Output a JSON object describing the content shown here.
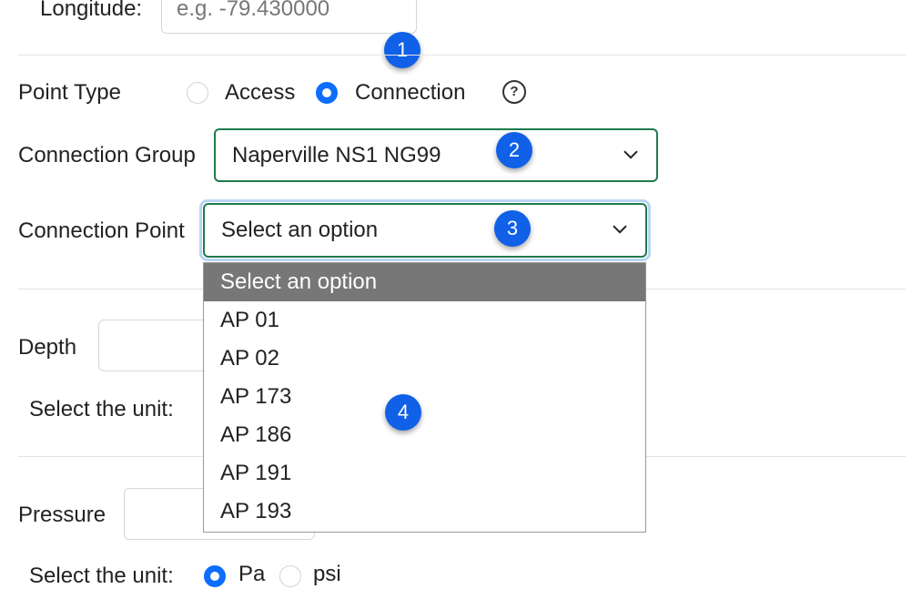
{
  "longitude": {
    "label": "Longitude:",
    "placeholder": "e.g. -79.430000",
    "unit": "°"
  },
  "point_type": {
    "label": "Point Type",
    "options": [
      "Access",
      "Connection"
    ],
    "selected": "Connection"
  },
  "connection_group": {
    "label": "Connection Group",
    "value": "Naperville NS1 NG99"
  },
  "connection_point": {
    "label": "Connection Point",
    "value": "Select an option",
    "options": [
      "Select an option",
      "AP 01",
      "AP 02",
      "AP 173",
      "AP 186",
      "AP 191",
      "AP 193"
    ]
  },
  "depth": {
    "label": "Depth",
    "unit_label": "Select the unit:"
  },
  "pressure": {
    "label": "Pressure",
    "unit_label": "Select the unit:",
    "units": [
      "Pa",
      "psi"
    ],
    "selected_unit": "Pa"
  },
  "badges": [
    "1",
    "2",
    "3",
    "4"
  ],
  "colors": {
    "accent": "#0d6efd",
    "badge": "#1060e8",
    "select_border": "#1f7a4d",
    "selected_option_bg": "#777777"
  }
}
